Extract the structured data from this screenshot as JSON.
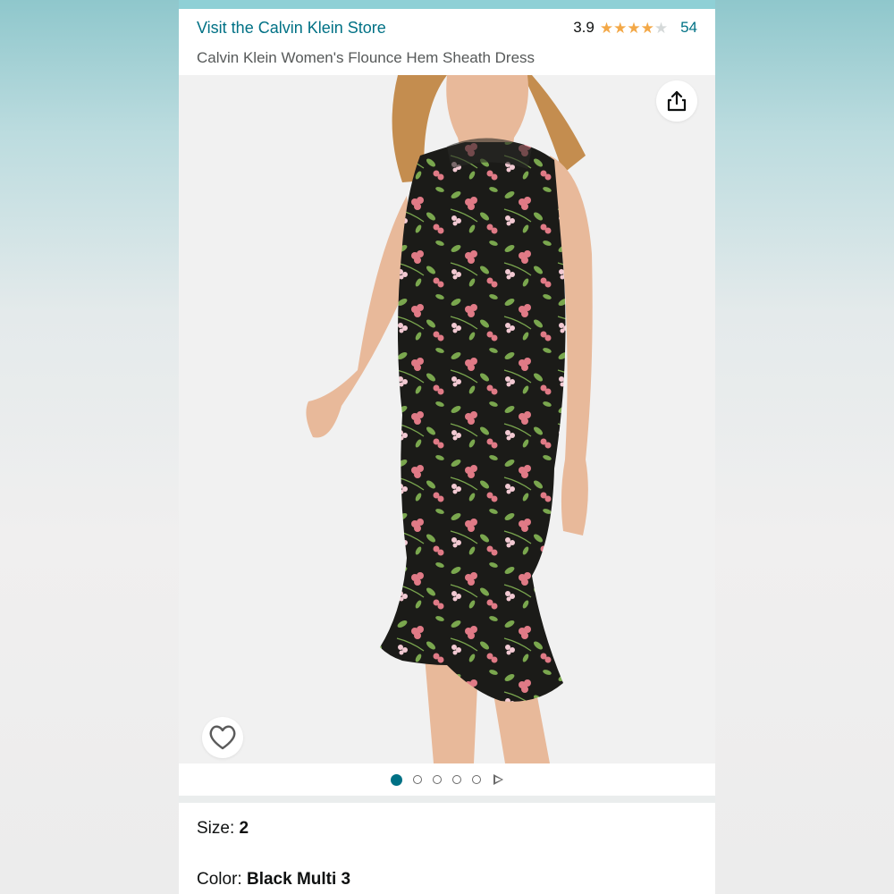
{
  "header": {
    "store_link": "Visit the Calvin Klein Store",
    "rating": "3.9",
    "stars": [
      "full",
      "full",
      "full",
      "full",
      "empty"
    ],
    "review_count": "54"
  },
  "product": {
    "title": "Calvin Klein Women's Flounce Hem Sheath Dress",
    "image": {
      "dress_colors": [
        "#1b1b18",
        "#e07a86",
        "#7aa74e",
        "#f2c9d2"
      ],
      "skin_color": "#e8b99a",
      "hair_color": "#c48d4f"
    }
  },
  "icons": {
    "share": "share-icon",
    "wishlist": "heart-icon"
  },
  "carousel": {
    "image_count": 5,
    "active_index": 0,
    "has_video": true
  },
  "options": {
    "size_label": "Size: ",
    "size_value": "2",
    "color_label": "Color: ",
    "color_value": "Black Multi 3"
  },
  "colors": {
    "link": "#007185",
    "star": "#f3a847",
    "star_empty": "#d5d9d9",
    "text": "#0f1111",
    "muted": "#565959"
  }
}
